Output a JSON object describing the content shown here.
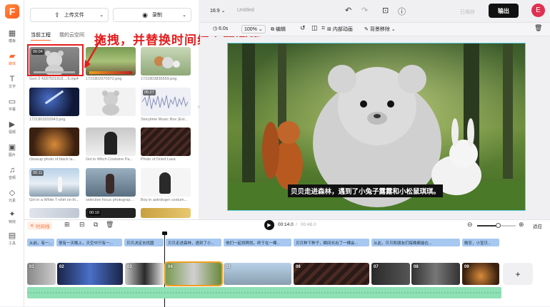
{
  "app": {
    "logo_letter": "F",
    "brand_color": "#ff6a2b"
  },
  "sidebar": {
    "items": [
      {
        "label": "模板",
        "icon": "grid-icon"
      },
      {
        "label": "媒体",
        "icon": "folder-icon"
      },
      {
        "label": "文字",
        "icon": "text-icon"
      },
      {
        "label": "字幕",
        "icon": "caption-icon"
      },
      {
        "label": "视频",
        "icon": "video-icon"
      },
      {
        "label": "图片",
        "icon": "image-icon"
      },
      {
        "label": "音频",
        "icon": "music-icon"
      },
      {
        "label": "元素",
        "icon": "shapes-icon"
      },
      {
        "label": "特效",
        "icon": "effects-icon"
      },
      {
        "label": "工具",
        "icon": "toolbox-icon"
      }
    ]
  },
  "media_panel": {
    "upload_label": "上传文件",
    "record_label": "录制",
    "tabs": [
      "当前工程",
      "我的云空间"
    ],
    "items": [
      {
        "caption": "Gen-2 4187501818....5.mp4",
        "duration": "00:04"
      },
      {
        "caption": "1721802970972.png",
        "duration": ""
      },
      {
        "caption": "1721803835559.png",
        "duration": ""
      },
      {
        "caption": "1721803203943.png",
        "duration": ""
      },
      {
        "caption": "",
        "duration": ""
      },
      {
        "caption": "Storytime Music Box (Ext...",
        "duration": "05:27"
      },
      {
        "caption": "closeup photo of black la...",
        "duration": ""
      },
      {
        "caption": "Girl in Witch Costume Pa...",
        "duration": ""
      },
      {
        "caption": "Photo of Dried Lava",
        "duration": ""
      },
      {
        "caption": "Girl in a White T-shirt on th...",
        "duration": "00:11"
      },
      {
        "caption": "selective focus photograp...",
        "duration": ""
      },
      {
        "caption": "Boy in astrologer costum...",
        "duration": ""
      },
      {
        "caption": "",
        "duration": ""
      },
      {
        "caption": "",
        "duration": "00:10"
      },
      {
        "caption": "",
        "duration": ""
      }
    ],
    "annotation": "拖拽，并替换时间线上的图片"
  },
  "topbar": {
    "aspect": "16:9",
    "title": "Untitled",
    "saved_label": "已保存",
    "export_label": "输出",
    "avatar_letter": "E"
  },
  "toolbar": {
    "duration": "6.0s",
    "zoom": "100%",
    "edit_label": "编辑",
    "animation_label": "内部动画",
    "bg_remove_label": "背景移除"
  },
  "preview": {
    "subtitle": "贝贝走进森林，遇到了小兔子露露和小松鼠琪琪。"
  },
  "timeline": {
    "label": "时间线",
    "current_time": "00:14.0",
    "total_time": "00:48.0",
    "fit_label": "适应",
    "zoom_level": 0.55,
    "subtitles": [
      "从前，有一...",
      "很有一天晚上，天空中只有一...",
      "贝贝决定去找圆",
      "贝贝走进森林，遇到了小...",
      "他们一起找啊找，终于在一棵...",
      "贝贝种下种子，瞬间长出了一棵会...",
      "从此，贝贝和朋友们每晚都能在...",
      "晚安，小宝贝..."
    ],
    "clips": [
      "01",
      "02",
      "03",
      "04",
      "05",
      "06",
      "07",
      "08",
      "09"
    ],
    "add_label": "+"
  }
}
